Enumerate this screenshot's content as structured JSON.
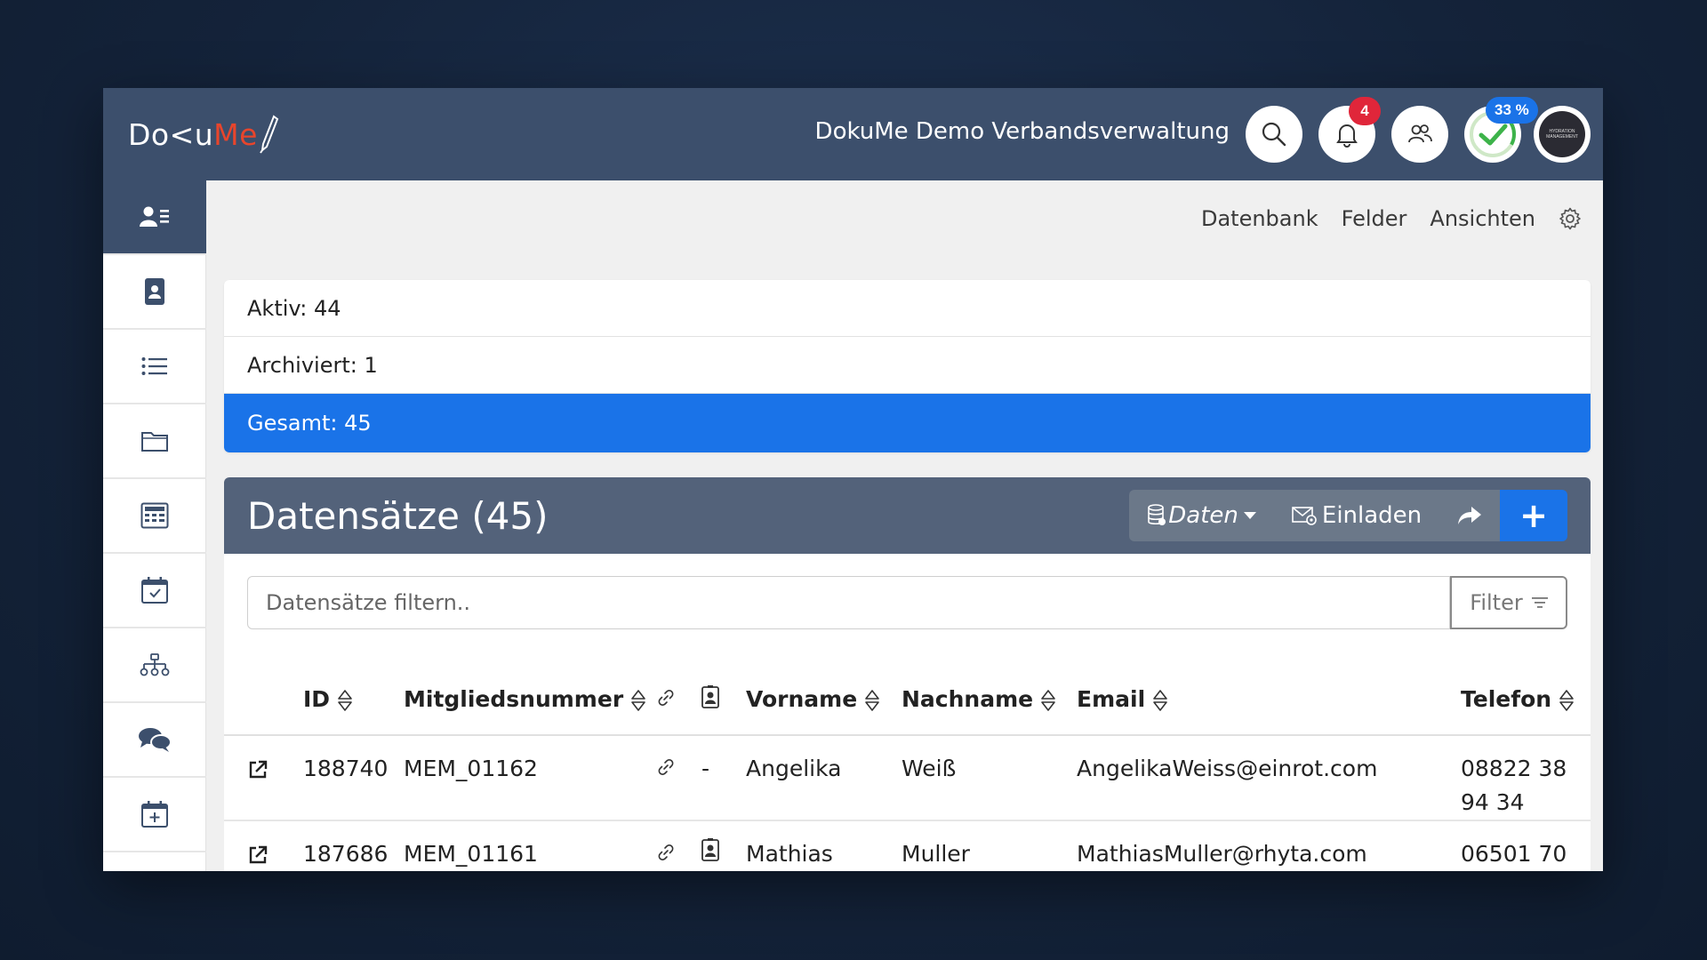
{
  "app": {
    "logo_left": "Do<uMe",
    "logo_main": "Do<u",
    "logo_accent": "Me",
    "org_name": "DokuMe Demo Verbandsverwaltung"
  },
  "topbar": {
    "notifications_count": "4",
    "progress_label": "33 %",
    "progress_value": 33,
    "avatar_text": "HYDRATION MANAGEMENT"
  },
  "colors": {
    "topbar": "#3c4f6c",
    "accent": "#1a73e8",
    "badge": "#e0263a",
    "brand_red": "#e8452c"
  },
  "sidebar": {
    "items": [
      {
        "icon": "contacts-list-icon",
        "active": true
      },
      {
        "icon": "id-card-icon"
      },
      {
        "icon": "list-icon"
      },
      {
        "icon": "folder-icon"
      },
      {
        "icon": "spreadsheet-icon"
      },
      {
        "icon": "calendar-check-icon"
      },
      {
        "icon": "org-chart-icon"
      },
      {
        "icon": "chat-bubbles-icon"
      },
      {
        "icon": "calendar-add-icon"
      }
    ]
  },
  "subnav": {
    "items": [
      "Datenbank",
      "Felder",
      "Ansichten"
    ]
  },
  "stats": {
    "active": "Aktiv: 44",
    "archived": "Archiviert: 1",
    "total": "Gesamt: 45"
  },
  "panel": {
    "title": "Datensätze (45)",
    "data_label": "Daten",
    "invite_label": "Einladen",
    "add_label": "+"
  },
  "filter": {
    "placeholder": "Datensätze filtern..",
    "button_label": "Filter"
  },
  "table": {
    "headers": {
      "id": "ID",
      "member_no": "Mitgliedsnummer",
      "first_name": "Vorname",
      "last_name": "Nachname",
      "email": "Email",
      "phone": "Telefon"
    },
    "rows": [
      {
        "id": "188740",
        "member_no": "MEM_01162",
        "card": "-",
        "first_name": "Angelika",
        "last_name": "Weiß",
        "email": "AngelikaWeiss@einrot.com",
        "phone": "08822 38 94 34"
      },
      {
        "id": "187686",
        "member_no": "MEM_01161",
        "card": "",
        "first_name": "Mathias",
        "last_name": "Muller",
        "email": "MathiasMuller@rhyta.com",
        "phone": "06501 70"
      }
    ]
  }
}
